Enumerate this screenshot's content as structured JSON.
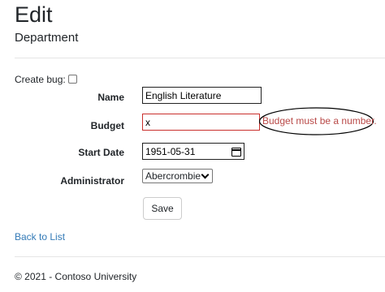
{
  "header": {
    "title": "Edit",
    "subtitle": "Department"
  },
  "form": {
    "create_bug_label": "Create bug:",
    "name": {
      "label": "Name",
      "value": "English Literature"
    },
    "budget": {
      "label": "Budget",
      "value": "x",
      "error": "Budget must be a number."
    },
    "start_date": {
      "label": "Start Date",
      "value": "1951-05-31"
    },
    "administrator": {
      "label": "Administrator",
      "selected": "Abercrombie"
    },
    "save_label": "Save"
  },
  "links": {
    "back": "Back to List"
  },
  "footer": {
    "text": "© 2021 - Contoso University"
  },
  "colors": {
    "error": "#b94a48",
    "link": "#337ab7",
    "invalid_border": "#c9302c"
  }
}
